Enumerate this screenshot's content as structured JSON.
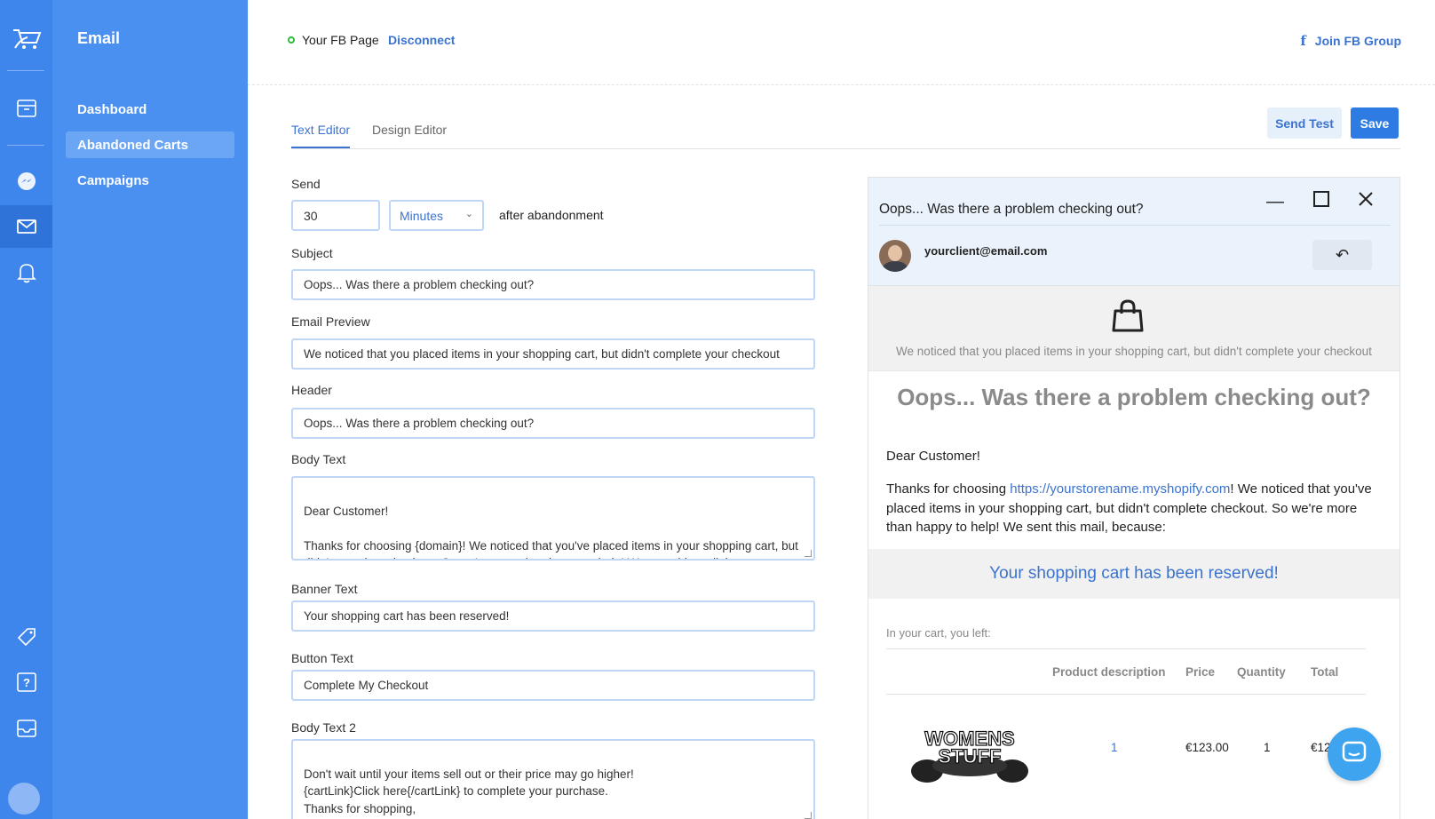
{
  "app": {
    "section_title": "Email"
  },
  "rail": {
    "icons": [
      "cart-logo-icon",
      "archive-icon",
      "messenger-icon",
      "mail-icon",
      "bell-icon",
      "tag-icon",
      "help-icon",
      "inbox-icon",
      "avatar"
    ]
  },
  "sidebar": {
    "items": [
      {
        "label": "Dashboard",
        "active": false
      },
      {
        "label": "Abandoned Carts",
        "active": true
      },
      {
        "label": "Campaigns",
        "active": false
      }
    ]
  },
  "topbar": {
    "fb_page": "Your FB Page",
    "disconnect": "Disconnect",
    "join_group": "Join FB Group"
  },
  "tabs": [
    {
      "label": "Text Editor",
      "active": true
    },
    {
      "label": "Design Editor",
      "active": false
    }
  ],
  "actions": {
    "send_test": "Send Test",
    "save": "Save"
  },
  "form": {
    "send_label": "Send",
    "send_value": "30",
    "send_unit": "Minutes",
    "after_text": "after abandonment",
    "subject_label": "Subject",
    "subject_value": "Oops... Was there a problem checking out?",
    "preview_label": "Email Preview",
    "preview_value": "We noticed that you placed items in your shopping cart, but didn't complete your checkout",
    "header_label": "Header",
    "header_value": "Oops... Was there a problem checking out?",
    "body_label": "Body Text",
    "body_value": "Dear Customer!\n\nThanks for choosing {domain}! We noticed that you've placed items in your shopping cart, but didn't complete checkout. So we're more than happy to help! We sent this mail, because:",
    "banner_label": "Banner Text",
    "banner_value": "Your shopping cart has been reserved!",
    "button_label": "Button Text",
    "button_value": "Complete My Checkout",
    "body2_label": "Body Text 2",
    "body2_value": "Don't wait until your items sell out or their price may go higher!\n{cartLink}Click here{/cartLink} to complete your purchase.\nThanks for shopping,\nThe {siteName} Team"
  },
  "preview": {
    "subject": "Oops... Was there a problem checking out?",
    "from_email": "yourclient@email.com",
    "preview_text": "We noticed that you placed items in your shopping cart, but didn't complete your checkout",
    "header": "Oops... Was there a problem checking out?",
    "dear": "Dear Customer!",
    "body_before_link": "Thanks for choosing ",
    "body_link": "https://yourstorename.myshopify.com",
    "body_after_link": "! We noticed that you've placed items in your shopping cart, but didn't complete checkout. So we're more than happy to help! We sent this mail, because:",
    "reserved": "Your shopping cart has been reserved!",
    "in_your_cart": "In your cart, you left:",
    "table_headers": [
      "Product description",
      "Price",
      "Quantity",
      "Total"
    ],
    "row": {
      "description": "1",
      "price": "€123.00",
      "quantity": "1",
      "total": "€123.00"
    },
    "product_image_text_1": "WOMENS",
    "product_image_text_2": "STUFF"
  },
  "colors": {
    "rail": "#3f86ec",
    "sidebar": "#4a90f0",
    "accent": "#3b73d1",
    "save_button": "#2f7be4",
    "status_dot": "#2ebd3e"
  }
}
